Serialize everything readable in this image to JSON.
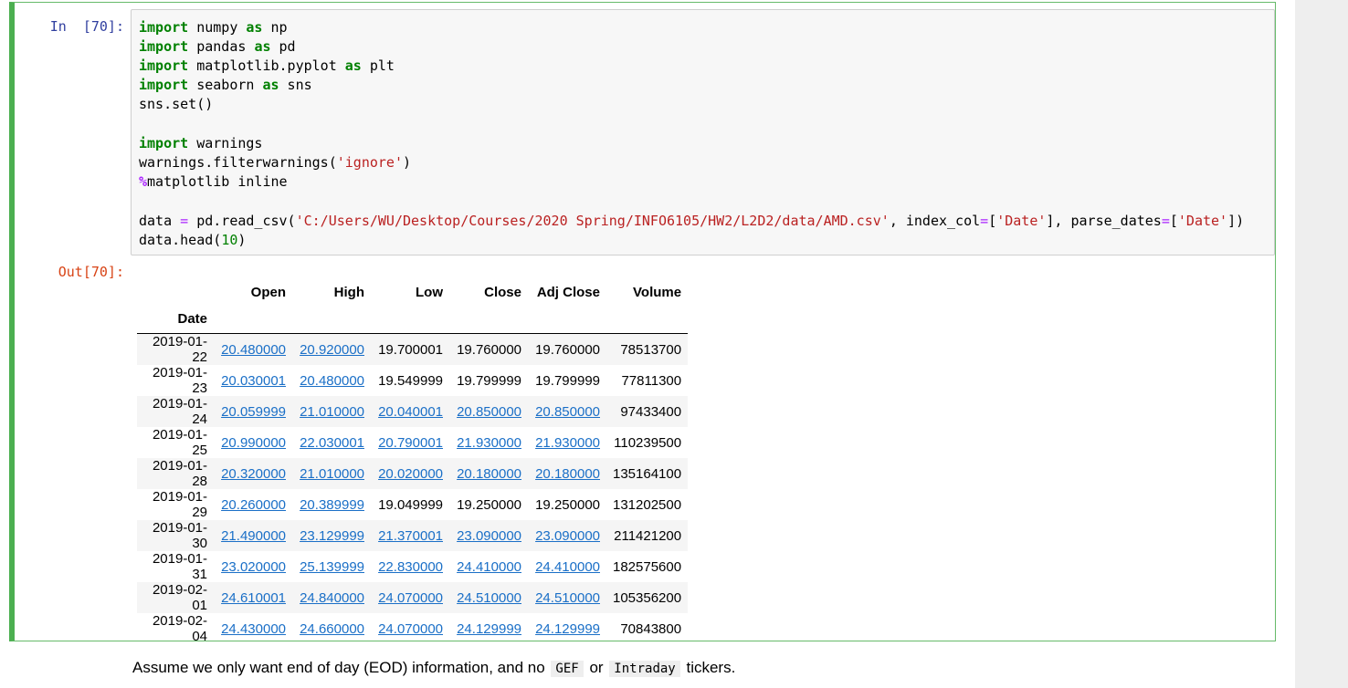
{
  "cell": {
    "in_prompt": "In  [70]:",
    "out_prompt": "Out[70]:"
  },
  "colors": {
    "cell_border": "#4caf50",
    "in_prompt": "#303f9f",
    "out_prompt": "#d84315",
    "link": "#1a6fc7"
  },
  "table": {
    "columns": [
      "Open",
      "High",
      "Low",
      "Close",
      "Adj Close",
      "Volume"
    ],
    "index_name": "Date",
    "rows": [
      {
        "date": "2019-01-22",
        "values": [
          "20.480000",
          "20.920000",
          "19.700001",
          "19.760000",
          "19.760000",
          "78513700"
        ],
        "links": [
          true,
          true,
          false,
          false,
          false,
          false
        ]
      },
      {
        "date": "2019-01-23",
        "values": [
          "20.030001",
          "20.480000",
          "19.549999",
          "19.799999",
          "19.799999",
          "77811300"
        ],
        "links": [
          true,
          true,
          false,
          false,
          false,
          false
        ]
      },
      {
        "date": "2019-01-24",
        "values": [
          "20.059999",
          "21.010000",
          "20.040001",
          "20.850000",
          "20.850000",
          "97433400"
        ],
        "links": [
          true,
          true,
          true,
          true,
          true,
          false
        ]
      },
      {
        "date": "2019-01-25",
        "values": [
          "20.990000",
          "22.030001",
          "20.790001",
          "21.930000",
          "21.930000",
          "110239500"
        ],
        "links": [
          true,
          true,
          true,
          true,
          true,
          false
        ]
      },
      {
        "date": "2019-01-28",
        "values": [
          "20.320000",
          "21.010000",
          "20.020000",
          "20.180000",
          "20.180000",
          "135164100"
        ],
        "links": [
          true,
          true,
          true,
          true,
          true,
          false
        ]
      },
      {
        "date": "2019-01-29",
        "values": [
          "20.260000",
          "20.389999",
          "19.049999",
          "19.250000",
          "19.250000",
          "131202500"
        ],
        "links": [
          true,
          true,
          false,
          false,
          false,
          false
        ]
      },
      {
        "date": "2019-01-30",
        "values": [
          "21.490000",
          "23.129999",
          "21.370001",
          "23.090000",
          "23.090000",
          "211421200"
        ],
        "links": [
          true,
          true,
          true,
          true,
          true,
          false
        ]
      },
      {
        "date": "2019-01-31",
        "values": [
          "23.020000",
          "25.139999",
          "22.830000",
          "24.410000",
          "24.410000",
          "182575600"
        ],
        "links": [
          true,
          true,
          true,
          true,
          true,
          false
        ]
      },
      {
        "date": "2019-02-01",
        "values": [
          "24.610001",
          "24.840000",
          "24.070000",
          "24.510000",
          "24.510000",
          "105356200"
        ],
        "links": [
          true,
          true,
          true,
          true,
          true,
          false
        ]
      },
      {
        "date": "2019-02-04",
        "values": [
          "24.430000",
          "24.660000",
          "24.070000",
          "24.129999",
          "24.129999",
          "70843800"
        ],
        "links": [
          true,
          true,
          true,
          true,
          true,
          false
        ]
      }
    ]
  },
  "markdown": {
    "before": "Assume we only want end of day (EOD) information, and no",
    "code1": "GEF",
    "mid": "or",
    "code2": "Intraday",
    "after": "tickers."
  }
}
